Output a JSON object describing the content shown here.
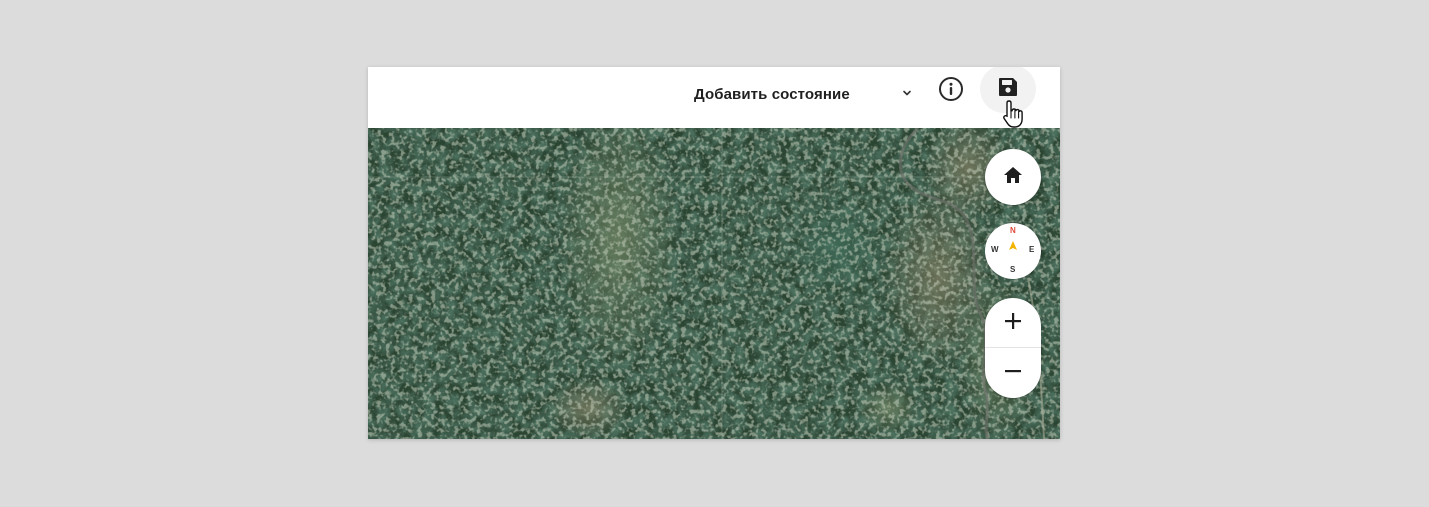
{
  "toolbar": {
    "state_select": {
      "label": "Добавить состояние",
      "icon": "chevron-down-icon"
    },
    "info_icon": "info-circle-icon",
    "save_icon": "floppy-disk-icon"
  },
  "map": {
    "type": "satellite-imagery",
    "controls": {
      "home_icon": "home-icon",
      "compass": {
        "north": "N",
        "south": "S",
        "west": "W",
        "east": "E",
        "north_color": "#e04a3a",
        "needle_color": "#f2b400"
      },
      "zoom_in": "+",
      "zoom_out": "−"
    }
  },
  "colors": {
    "forest_dark": "#1f3a2a",
    "forest_mid": "#2d4a35",
    "meadow": "#5f7a58",
    "toolbar_bg": "#ffffff",
    "save_bg": "#f2f2f2"
  }
}
